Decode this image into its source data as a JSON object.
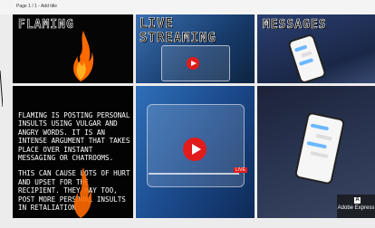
{
  "page_label": "Page 1 / 1 - Add title",
  "tiles": {
    "flaming": {
      "title": "FLAMING"
    },
    "live": {
      "title_line1": "LIVE",
      "title_line2": "STREAMING"
    },
    "messages": {
      "title": "MESSAGES"
    },
    "description": {
      "paragraph1": "Flaming is posting personal insults using vulgar and angry words. It is an intense argument that takes place over instant messaging or chatrooms.",
      "paragraph2": "This can cause lots of hurt and upset for the recipient. They may too, post more personal insults in retaliation"
    },
    "video": {
      "live_badge": "LIVE"
    }
  },
  "brand": {
    "logo": "A",
    "label": "Adobe Express"
  },
  "colors": {
    "play_red": "#e21b1b",
    "flame_orange": "#ff6a00"
  }
}
